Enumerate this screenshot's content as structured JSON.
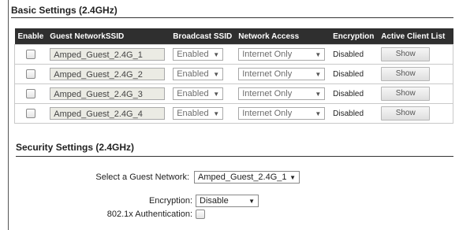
{
  "basic": {
    "title": "Basic Settings (2.4GHz)",
    "columns": [
      "Enable",
      "Guest NetworkSSID",
      "Broadcast SSID",
      "Network Access",
      "Encryption",
      "Active Client List"
    ],
    "rows": [
      {
        "enabled": false,
        "ssid": "Amped_Guest_2.4G_1",
        "broadcast": "Enabled",
        "access": "Internet Only",
        "encryption": "Disabled",
        "action": "Show"
      },
      {
        "enabled": false,
        "ssid": "Amped_Guest_2.4G_2",
        "broadcast": "Enabled",
        "access": "Internet Only",
        "encryption": "Disabled",
        "action": "Show"
      },
      {
        "enabled": false,
        "ssid": "Amped_Guest_2.4G_3",
        "broadcast": "Enabled",
        "access": "Internet Only",
        "encryption": "Disabled",
        "action": "Show"
      },
      {
        "enabled": false,
        "ssid": "Amped_Guest_2.4G_4",
        "broadcast": "Enabled",
        "access": "Internet Only",
        "encryption": "Disabled",
        "action": "Show"
      }
    ]
  },
  "security": {
    "title": "Security Settings (2.4GHz)",
    "select_label": "Select a Guest Network:",
    "select_value": "Amped_Guest_2.4G_1",
    "encryption_label": "Encryption:",
    "encryption_value": "Disable",
    "auth_label": "802.1x Authentication:",
    "auth_checked": false
  },
  "icons": {
    "dropdown": "chevron-down-icon"
  },
  "colors": {
    "header_bg": "#2f2f2f",
    "ssid_field_bg": "#ebebe4"
  }
}
